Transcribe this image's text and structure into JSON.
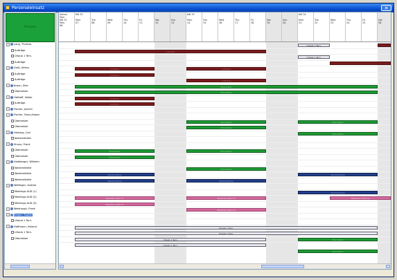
{
  "window": {
    "title": "Personaleinsatz",
    "close_glyph": "✕"
  },
  "tree": {
    "header_label": "Personal",
    "nodes": [
      {
        "label": "Lang, Thomas",
        "level": 0,
        "icon": "person"
      },
      {
        "label": "Aufträge",
        "level": 1,
        "icon": "doc"
      },
      {
        "label": "Urlaub 1 Tern.",
        "level": 1,
        "icon": "doc"
      },
      {
        "label": "Aufträge",
        "level": 1,
        "icon": "doc"
      },
      {
        "label": "Groß, Alfons",
        "level": 0,
        "icon": "person"
      },
      {
        "label": "Aufträge",
        "level": 1,
        "icon": "doc"
      },
      {
        "label": "Aufträge",
        "level": 1,
        "icon": "doc"
      },
      {
        "label": "Braun, Elke",
        "level": 0,
        "icon": "person"
      },
      {
        "label": "Übersetzer",
        "level": 1,
        "icon": "doc"
      },
      {
        "label": "Hettiaff, Volker",
        "level": 0,
        "icon": "person"
      },
      {
        "label": "Aufträge",
        "level": 1,
        "icon": "doc"
      },
      {
        "label": "Fischer, Jochen",
        "level": 0,
        "icon": "person"
      },
      {
        "label": "Fischer, Hans-Jürgen",
        "level": 0,
        "icon": "person"
      },
      {
        "label": "Übersetzer",
        "level": 1,
        "icon": "doc"
      },
      {
        "label": "Übersetzer",
        "level": 1,
        "icon": "doc"
      },
      {
        "label": "Herberg, Carl",
        "level": 0,
        "icon": "person"
      },
      {
        "label": "Kostenstellen",
        "level": 1,
        "icon": "doc"
      },
      {
        "label": "Sirano, Frank",
        "level": 0,
        "icon": "person"
      },
      {
        "label": "Übersetzer",
        "level": 1,
        "icon": "doc"
      },
      {
        "label": "Übersetzer",
        "level": 1,
        "icon": "doc"
      },
      {
        "label": "Heidberger, Wilhelm",
        "level": 0,
        "icon": "person"
      },
      {
        "label": "Wartemittelle",
        "level": 1,
        "icon": "doc"
      },
      {
        "label": "Wartemittelle",
        "level": 1,
        "icon": "doc"
      },
      {
        "label": "Wartemittelle",
        "level": 1,
        "icon": "doc"
      },
      {
        "label": "Wolfinger, Andrea",
        "level": 0,
        "icon": "person"
      },
      {
        "label": "Meetings AUD (1)",
        "level": 1,
        "icon": "doc"
      },
      {
        "label": "Meetings AUD (2)",
        "level": 1,
        "icon": "doc"
      },
      {
        "label": "Meetings AUD (3)",
        "level": 1,
        "icon": "doc"
      },
      {
        "label": "Weishaupt, Frank",
        "level": 0,
        "icon": "person"
      },
      {
        "label": "Berger, Sophie",
        "level": 0,
        "icon": "person",
        "selected": true
      },
      {
        "label": "Urlaub 1 Tern.",
        "level": 1,
        "icon": "doc"
      },
      {
        "label": "Hoffmann, Helmut",
        "level": 0,
        "icon": "person"
      },
      {
        "label": "Urlaub 1 Tern.",
        "level": 1,
        "icon": "doc"
      },
      {
        "label": "Übersetzer",
        "level": 1,
        "icon": "doc"
      }
    ]
  },
  "calendar": {
    "corner_label": "Datum\nMon\nKW 32\nMon.\n06.",
    "days": [
      {
        "week": "KW 32",
        "label": "Mon.\n07.",
        "weekend": false
      },
      {
        "week": "",
        "label": "Tue.\n08.",
        "weekend": false
      },
      {
        "week": "",
        "label": "Wed.\n09.",
        "weekend": false
      },
      {
        "week": "",
        "label": "Thu.\n10.",
        "weekend": false
      },
      {
        "week": "",
        "label": "Fri.\n11.",
        "weekend": false
      },
      {
        "week": "",
        "label": "Sat.\n12.",
        "weekend": true
      },
      {
        "week": "",
        "label": "Sun.\n13.",
        "weekend": true
      },
      {
        "week": "KW 33",
        "label": "Mon.\n14.",
        "weekend": false
      },
      {
        "week": "",
        "label": "Tue.\n15.",
        "weekend": false
      },
      {
        "week": "",
        "label": "Wed.\n16.",
        "weekend": false
      },
      {
        "week": "",
        "label": "Thu.\n17.",
        "weekend": false
      },
      {
        "week": "",
        "label": "Fri.\n18.",
        "weekend": false
      },
      {
        "week": "",
        "label": "Sat.\n19.",
        "weekend": true
      },
      {
        "week": "",
        "label": "Sun.\n20.",
        "weekend": true
      },
      {
        "week": "KW 34",
        "label": "Mon.\n21.",
        "weekend": false
      },
      {
        "week": "",
        "label": "Tue.\n22.",
        "weekend": false
      },
      {
        "week": "",
        "label": "Wed.\n23.",
        "weekend": false
      },
      {
        "week": "",
        "label": "Thu.\n24.",
        "weekend": false
      },
      {
        "week": "",
        "label": "Fri.\n25.",
        "weekend": false
      },
      {
        "week": "",
        "label": "Sat.\n26.",
        "weekend": true
      }
    ],
    "bars": [
      {
        "row": 0,
        "start": 19,
        "end": 20,
        "color": "dark-red",
        "label": ""
      },
      {
        "row": 0,
        "start": 14,
        "end": 16,
        "color": "grey",
        "label": "Urlaub 1 Tern."
      },
      {
        "row": 1,
        "start": 0,
        "end": 12,
        "color": "dark-red",
        "label": "Aufträge"
      },
      {
        "row": 2,
        "start": 14,
        "end": 16,
        "color": "grey",
        "label": "Urlaub 1 Tern."
      },
      {
        "row": 3,
        "start": 16,
        "end": 20,
        "color": "dark-red",
        "label": ""
      },
      {
        "row": 4,
        "start": 0,
        "end": 5,
        "color": "dark-red",
        "label": "Aufträge"
      },
      {
        "row": 4,
        "start": 7,
        "end": 12,
        "color": "dark-red",
        "label": "Aufträge"
      },
      {
        "row": 5,
        "start": 0,
        "end": 5,
        "color": "dark-red",
        "label": "Aufträge"
      },
      {
        "row": 6,
        "start": 7,
        "end": 12,
        "color": "dark-red",
        "label": "Aufträge"
      },
      {
        "row": 7,
        "start": 0,
        "end": 19,
        "color": "green",
        "label": "Übersetzer"
      },
      {
        "row": 8,
        "start": 0,
        "end": 19,
        "color": "green",
        "label": "Übersetzer"
      },
      {
        "row": 9,
        "start": 0,
        "end": 5,
        "color": "dark-red",
        "label": "Aufträge"
      },
      {
        "row": 10,
        "start": 0,
        "end": 5,
        "color": "dark-red",
        "label": "Aufträge"
      },
      {
        "row": 13,
        "start": 7,
        "end": 12,
        "color": "green",
        "label": "Übersetzer"
      },
      {
        "row": 13,
        "start": 14,
        "end": 19,
        "color": "green",
        "label": "Übersetzer"
      },
      {
        "row": 14,
        "start": 7,
        "end": 12,
        "color": "green",
        "label": "Übersetzer"
      },
      {
        "row": 15,
        "start": 14,
        "end": 19,
        "color": "green",
        "label": "Übersetzer"
      },
      {
        "row": 18,
        "start": 0,
        "end": 5,
        "color": "green",
        "label": "Übersetzer"
      },
      {
        "row": 18,
        "start": 7,
        "end": 12,
        "color": "green",
        "label": "Übersetzer"
      },
      {
        "row": 19,
        "start": 0,
        "end": 5,
        "color": "green",
        "label": "Übersetzer"
      },
      {
        "row": 21,
        "start": 7,
        "end": 12,
        "color": "green",
        "label": "Übersetzer"
      },
      {
        "row": 22,
        "start": 0,
        "end": 5,
        "color": "navy",
        "label": "Wartemittelle"
      },
      {
        "row": 22,
        "start": 14,
        "end": 19,
        "color": "navy",
        "label": "Wartemittelle"
      },
      {
        "row": 23,
        "start": 0,
        "end": 5,
        "color": "navy",
        "label": "Wartemittelle"
      },
      {
        "row": 23,
        "start": 7,
        "end": 12,
        "color": "navy",
        "label": "Wartemittelle"
      },
      {
        "row": 25,
        "start": 14,
        "end": 19,
        "color": "navy",
        "label": "Wartemittelle"
      },
      {
        "row": 26,
        "start": 0,
        "end": 5,
        "color": "pink",
        "label": "Meetings AUD (1)"
      },
      {
        "row": 26,
        "start": 7,
        "end": 12,
        "color": "pink",
        "label": "Meetings AUD (1)"
      },
      {
        "row": 26,
        "start": 16,
        "end": 20,
        "color": "pink",
        "label": "Meetings AUD (1)"
      },
      {
        "row": 27,
        "start": 0,
        "end": 5,
        "color": "pink",
        "label": "Meetings AUD (2)"
      },
      {
        "row": 28,
        "start": 7,
        "end": 12,
        "color": "pink",
        "label": "Meetings AUD (3)"
      },
      {
        "row": 31,
        "start": 0,
        "end": 19,
        "color": "grey",
        "label": "Urlaub 1 Tern."
      },
      {
        "row": 32,
        "start": 0,
        "end": 19,
        "color": "grey",
        "label": "Urlaub 1 Tern."
      },
      {
        "row": 33,
        "start": 0,
        "end": 12,
        "color": "grey",
        "label": "Urlaub 1 Tern."
      },
      {
        "row": 33,
        "start": 14,
        "end": 19,
        "color": "green",
        "label": "Übersetzer"
      },
      {
        "row": 34,
        "start": 0,
        "end": 12,
        "color": "grey",
        "label": "Urlaub 1 Tern."
      },
      {
        "row": 35,
        "start": 14,
        "end": 19,
        "color": "green",
        "label": "Übersetzer"
      }
    ]
  }
}
